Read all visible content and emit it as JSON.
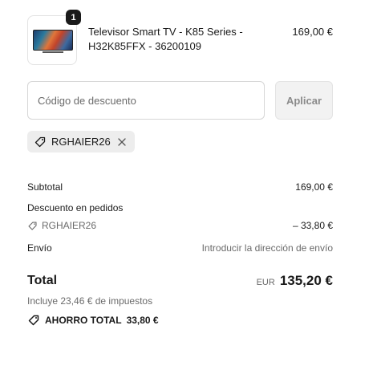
{
  "product": {
    "quantity": "1",
    "title": "Televisor Smart TV - K85 Series - H32K85FFX - 36200109",
    "price": "169,00 €"
  },
  "discount": {
    "placeholder": "Código de descuento",
    "value": "",
    "apply_label": "Aplicar",
    "applied_code": "RGHAIER26"
  },
  "summary": {
    "subtotal_label": "Subtotal",
    "subtotal_value": "169,00 €",
    "order_discount_label": "Descuento en pedidos",
    "order_discount_code": "RGHAIER26",
    "order_discount_value": "– 33,80 €",
    "shipping_label": "Envío",
    "shipping_value": "Introducir la dirección de envío",
    "total_label": "Total",
    "total_currency": "EUR",
    "total_value": "135,20 €",
    "taxes_note": "Incluye 23,46 € de impuestos",
    "savings_label": "AHORRO TOTAL",
    "savings_value": "33,80 €"
  },
  "icons": {
    "tag": "tag-icon",
    "close": "close-icon"
  }
}
